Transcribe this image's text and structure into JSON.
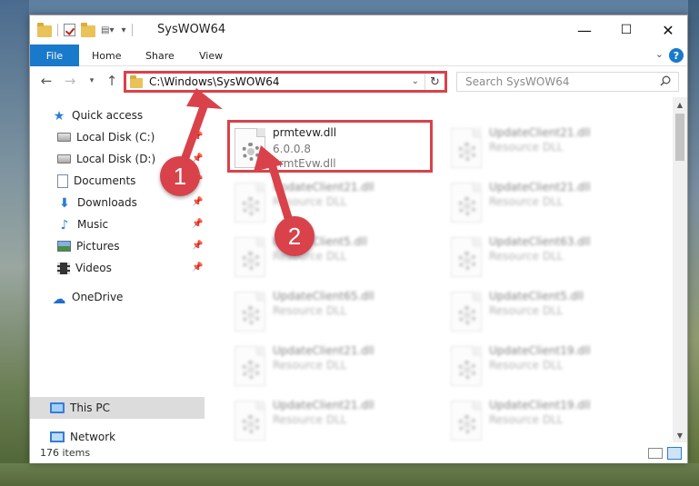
{
  "window": {
    "title": "SysWOW64",
    "controls": {
      "minimize": "—",
      "maximize": "☐",
      "close": "✕"
    }
  },
  "ribbon": {
    "file": "File",
    "home": "Home",
    "share": "Share",
    "view": "View",
    "help": "?"
  },
  "address_bar": {
    "path": "C:\\Windows\\SysWOW64",
    "search_placeholder": "Search SysWOW64"
  },
  "nav_pane": {
    "quick_access": "Quick access",
    "items": [
      {
        "label": "Local Disk (C:)",
        "pinned": true
      },
      {
        "label": "Local Disk (D:)",
        "pinned": true
      },
      {
        "label": "Documents",
        "pinned": true
      },
      {
        "label": "Downloads",
        "pinned": true
      },
      {
        "label": "Music",
        "pinned": true
      },
      {
        "label": "Pictures",
        "pinned": true
      },
      {
        "label": "Videos",
        "pinned": true
      }
    ],
    "onedrive": "OneDrive",
    "this_pc": "This PC",
    "network": "Network"
  },
  "files": [
    {
      "name": "prmtevw.dll",
      "version": "6.0.0.8",
      "description": "PrmtEvw.dll",
      "highlighted": true
    },
    {
      "name": "UpdateClient21.dll",
      "version": "",
      "description": "Resource DLL"
    },
    {
      "name": "UpdateClient21.dll",
      "version": "",
      "description": "Resource DLL"
    },
    {
      "name": "UpdateClient21.dll",
      "version": "",
      "description": "Resource DLL"
    },
    {
      "name": "UpdateClient5.dll",
      "version": "",
      "description": "Resource DLL"
    },
    {
      "name": "UpdateClient63.dll",
      "version": "",
      "description": "Resource DLL"
    },
    {
      "name": "UpdateClient65.dll",
      "version": "",
      "description": "Resource DLL"
    },
    {
      "name": "UpdateClient5.dll",
      "version": "",
      "description": "Resource DLL"
    },
    {
      "name": "UpdateClient21.dll",
      "version": "",
      "description": "Resource DLL"
    },
    {
      "name": "UpdateClient19.dll",
      "version": "",
      "description": "Resource DLL"
    },
    {
      "name": "UpdateClient21.dll",
      "version": "",
      "description": "Resource DLL"
    },
    {
      "name": "UpdateClient19.dll",
      "version": "",
      "description": "Resource DLL"
    }
  ],
  "status_bar": {
    "item_count": "176 items"
  },
  "annotations": {
    "step1": "1",
    "step2": "2",
    "accent_color": "#d9424a"
  }
}
